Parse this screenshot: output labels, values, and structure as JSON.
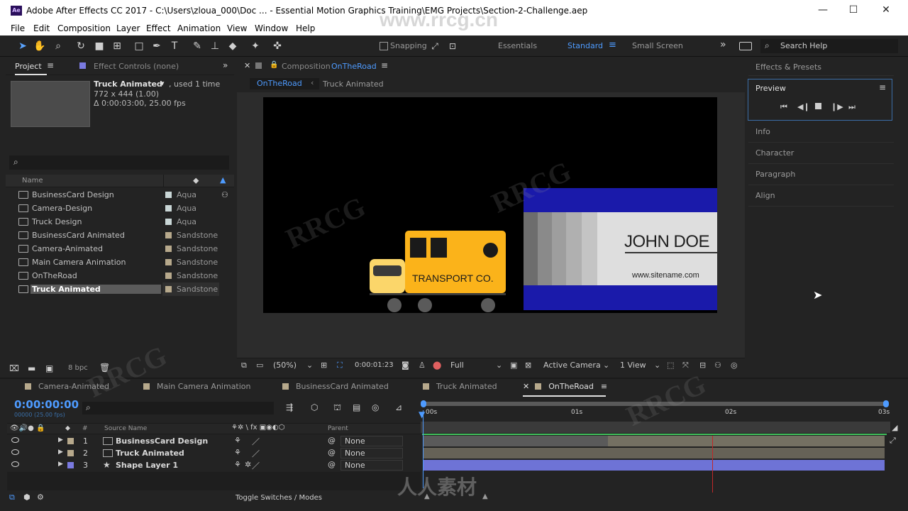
{
  "window": {
    "app_icon": "Ae",
    "title": "Adobe After Effects CC 2017 - C:\\Users\\zloua_000\\Doc ... - Essential Motion Graphics Training\\EMG Projects\\Section-2-Challenge.aep",
    "minimize": "—",
    "maximize": "☐",
    "close": "✕"
  },
  "menu": [
    "File",
    "Edit",
    "Composition",
    "Layer",
    "Effect",
    "Animation",
    "View",
    "Window",
    "Help"
  ],
  "toolbar": {
    "snapping_label": "Snapping",
    "workspaces": [
      "Essentials",
      "Standard",
      "Small Screen"
    ],
    "active_workspace": "Standard",
    "more": "»",
    "search_placeholder": "Search Help"
  },
  "project": {
    "tab_label": "Project",
    "effect_controls_label": "Effect Controls (none)",
    "selected_name": "Truck Animated",
    "used": ", used 1 time",
    "dimensions": "772 x 444 (1.00)",
    "duration": "Δ 0:00:03:00, 25.00 fps",
    "search_placeholder": "",
    "col_name": "Name",
    "items": [
      {
        "name": "BusinessCard Design",
        "label": "Aqua",
        "color": "#c9d6d6"
      },
      {
        "name": "Camera-Design",
        "label": "Aqua",
        "color": "#c9d6d6"
      },
      {
        "name": "Truck Design",
        "label": "Aqua",
        "color": "#c9d6d6"
      },
      {
        "name": "BusinessCard Animated",
        "label": "Sandstone",
        "color": "#b7a98c"
      },
      {
        "name": "Camera-Animated",
        "label": "Sandstone",
        "color": "#b7a98c"
      },
      {
        "name": "Main Camera Animation",
        "label": "Sandstone",
        "color": "#b7a98c"
      },
      {
        "name": "OnTheRoad",
        "label": "Sandstone",
        "color": "#b7a98c"
      },
      {
        "name": "Truck Animated",
        "label": "Sandstone",
        "color": "#b7a98c",
        "selected": true
      }
    ],
    "bpc": "8 bpc"
  },
  "composition": {
    "tab_prefix": "Composition",
    "tab_name": "OnTheRoad",
    "breadcrumbs": [
      "OnTheRoad",
      "Truck Animated"
    ],
    "truck_text": "TRANSPORT CO.",
    "card_name": "JOHN DOE",
    "card_site": "www.sitename.com",
    "zoom": "(50%)",
    "timecode": "0:00:01:23",
    "resolution": "Full",
    "camera": "Active Camera",
    "views": "1 View"
  },
  "right_panels": {
    "effects_presets": "Effects & Presets",
    "preview": "Preview",
    "info": "Info",
    "character": "Character",
    "paragraph": "Paragraph",
    "align": "Align"
  },
  "timeline": {
    "tabs": [
      {
        "name": "Camera-Animated",
        "color": "#b7a98c"
      },
      {
        "name": "Main Camera Animation",
        "color": "#b7a98c"
      },
      {
        "name": "BusinessCard Animated",
        "color": "#b7a98c"
      },
      {
        "name": "Truck Animated",
        "color": "#b7a98c"
      },
      {
        "name": "OnTheRoad",
        "color": "#b7a98c",
        "active": true
      }
    ],
    "current_time": "0:00:00:00",
    "frame_info": "00000 (25.00 fps)",
    "col_source": "Source Name",
    "col_parent": "Parent",
    "col_hash": "#",
    "ruler": [
      "00s",
      "01s",
      "02s",
      "03s"
    ],
    "layers": [
      {
        "num": "1",
        "name": "BusinessCard Design",
        "parent": "None",
        "type": "comp"
      },
      {
        "num": "2",
        "name": "Truck Animated",
        "parent": "None",
        "type": "comp"
      },
      {
        "num": "3",
        "name": "Shape Layer 1",
        "parent": "None",
        "type": "shape"
      }
    ],
    "toggle_label": "Toggle Switches / Modes"
  },
  "watermarks": [
    "www.rrcg.cn",
    "RRCG",
    "人人素材"
  ]
}
